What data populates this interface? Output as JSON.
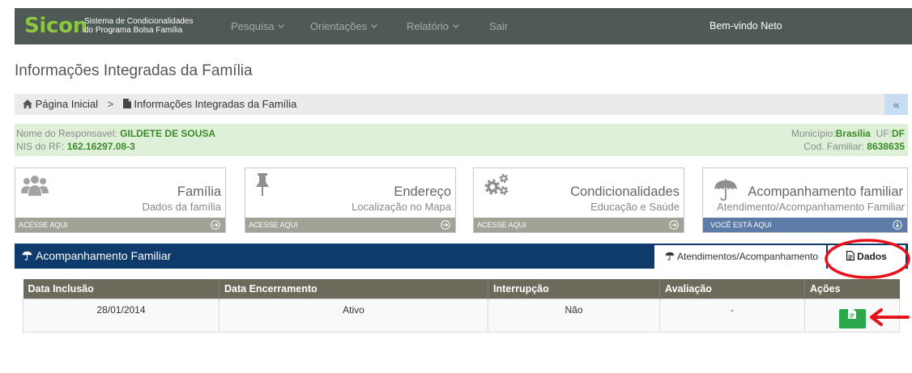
{
  "navbar": {
    "logo": "Sicon",
    "logo_subtitle_line1": "Sistema de Condicionalidades",
    "logo_subtitle_line2": "do Programa Bolsa Família",
    "menu": [
      {
        "label": "Pesquisa",
        "has_dropdown": true
      },
      {
        "label": "Orientações",
        "has_dropdown": true
      },
      {
        "label": "Relatório",
        "has_dropdown": true
      },
      {
        "label": "Sair",
        "has_dropdown": false
      }
    ],
    "welcome": "Bem-vindo Neto"
  },
  "page_title": "Informações Integradas da Família",
  "breadcrumb": {
    "home_icon": "home-icon",
    "home_label": "Página Inicial",
    "separator": ">",
    "current_icon": "file-icon",
    "current_label": "Informações Integradas da Família",
    "collapse_label": "«"
  },
  "family_info": {
    "responsible_label": "Nome do Responsavel:",
    "responsible_name": "GILDETE DE SOUSA",
    "nis_label": "NIS do RF:",
    "nis_value": "162.16297.08-3",
    "municipio_label": "Município:",
    "municipio_value": "Brasília",
    "uf_label": "UF:",
    "uf_value": "DF",
    "cod_label": "Cod. Familiar:",
    "cod_value": "8638635"
  },
  "cards": [
    {
      "title": "Família",
      "subtitle": "Dados da família",
      "footer": "ACESSE AQUI",
      "icon": "users-icon",
      "footer_icon": "circle-arrow-right-icon",
      "active": false
    },
    {
      "title": "Endereço",
      "subtitle": "Localização no Mapa",
      "footer": "ACESSE AQUI",
      "icon": "pushpin-icon",
      "footer_icon": "circle-arrow-right-icon",
      "active": false
    },
    {
      "title": "Condicionalidades",
      "subtitle": "Educação e Saúde",
      "footer": "ACESSE AQUI",
      "icon": "gears-icon",
      "footer_icon": "circle-arrow-right-icon",
      "active": false
    },
    {
      "title": "Acompanhamento familiar",
      "subtitle": "Atendimento/Acompanhamento Familiar",
      "footer": "VOCÊ ESTÁ AQUI",
      "icon": "umbrella-icon",
      "footer_icon": "circle-arrow-down-icon",
      "active": true
    }
  ],
  "section": {
    "title": "Acompanhamento Familiar",
    "icon": "umbrella-icon",
    "tabs": [
      {
        "label": "Atendimentos/Acompanhamento",
        "icon": "umbrella-icon",
        "active": true
      },
      {
        "label": "Dados",
        "icon": "file-text-icon",
        "active": false
      }
    ]
  },
  "table": {
    "columns": [
      "Data Inclusão",
      "Data Encerramento",
      "Interrupção",
      "Avaliação",
      "Ações"
    ],
    "rows": [
      {
        "data_inclusao": "28/01/2014",
        "data_encerramento": "Ativo",
        "interrupcao": "Não",
        "avaliacao": "-",
        "action_icon": "file-text-icon"
      }
    ]
  },
  "colors": {
    "navbar": "#4f5a56",
    "brand": "#8dc63f",
    "info_panel": "#dff0d8",
    "section_bar": "#0f3a6c",
    "card_footer": "#a3a296",
    "active_card_footer": "#5c7ba6",
    "table_header": "#6d6a5c",
    "action_button": "#2ba84a",
    "annotation": "#e8121b"
  }
}
